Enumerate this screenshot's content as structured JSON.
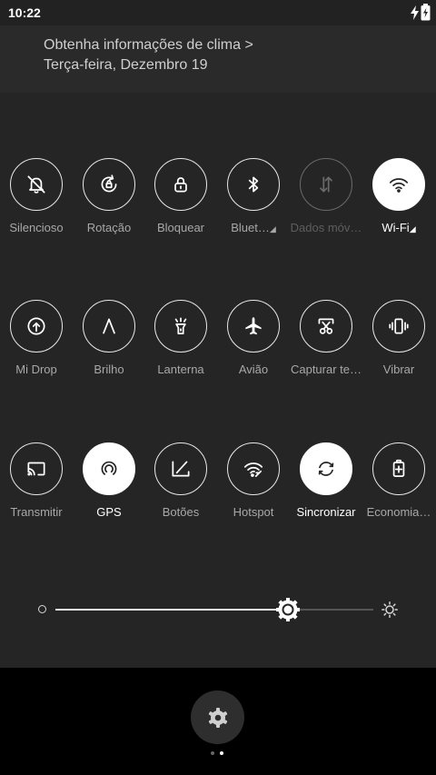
{
  "status_bar": {
    "time": "10:22",
    "icons": [
      "charging-bolt-icon",
      "battery-icon"
    ]
  },
  "header": {
    "weather_link": "Obtenha informações de clima >",
    "date": "Terça-feira, Dezembro 19"
  },
  "tiles": [
    {
      "label": "Silencioso",
      "icon": "bell-off-icon",
      "state": "off"
    },
    {
      "label": "Rotação",
      "icon": "rotation-lock-icon",
      "state": "off"
    },
    {
      "label": "Bloquear",
      "icon": "lock-icon",
      "state": "off"
    },
    {
      "label": "Bluet…",
      "icon": "bluetooth-icon",
      "state": "off",
      "has_menu": true
    },
    {
      "label": "Dados móv…",
      "icon": "mobile-data-icon",
      "state": "disabled"
    },
    {
      "label": "Wi-Fi",
      "icon": "wifi-icon",
      "state": "active",
      "has_menu": true
    },
    {
      "label": "Mi Drop",
      "icon": "mi-drop-icon",
      "state": "off"
    },
    {
      "label": "Brilho",
      "icon": "auto-brightness-icon",
      "state": "off"
    },
    {
      "label": "Lanterna",
      "icon": "flashlight-icon",
      "state": "off"
    },
    {
      "label": "Avião",
      "icon": "airplane-icon",
      "state": "off"
    },
    {
      "label": "Capturar te…",
      "icon": "screenshot-icon",
      "state": "off"
    },
    {
      "label": "Vibrar",
      "icon": "vibrate-icon",
      "state": "off"
    },
    {
      "label": "Transmitir",
      "icon": "cast-icon",
      "state": "off"
    },
    {
      "label": "GPS",
      "icon": "gps-icon",
      "state": "active"
    },
    {
      "label": "Botões",
      "icon": "buttons-icon",
      "state": "off"
    },
    {
      "label": "Hotspot",
      "icon": "hotspot-icon",
      "state": "off"
    },
    {
      "label": "Sincronizar",
      "icon": "sync-icon",
      "state": "active"
    },
    {
      "label": "Economia…",
      "icon": "battery-saver-icon",
      "state": "off"
    }
  ],
  "brightness": {
    "level": 0.73,
    "min_icon": "brightness-low-icon",
    "max_icon": "brightness-high-icon"
  },
  "colors": {
    "panel": "#252525",
    "active": "#ffffff",
    "inactive_label": "#a8a8a8"
  },
  "footer": {
    "settings_icon": "gear-icon",
    "page_count": 2,
    "current_page": 2
  }
}
